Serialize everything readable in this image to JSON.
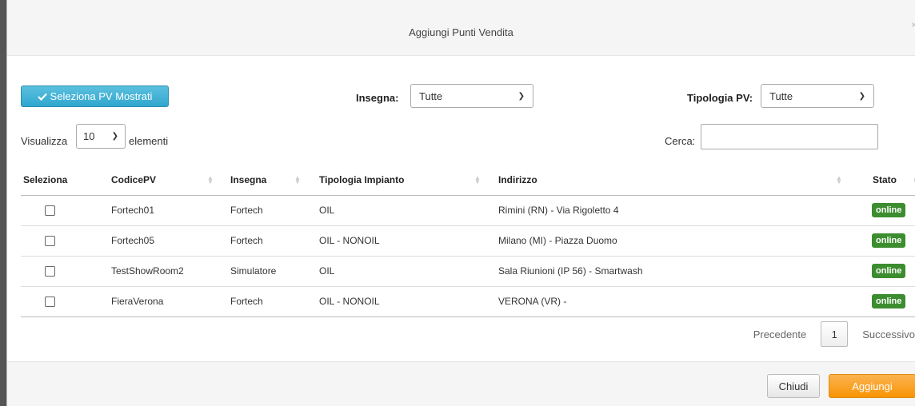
{
  "modal": {
    "title": "Aggiungi Punti Vendita",
    "close_symbol": "×"
  },
  "toolbar": {
    "select_shown_label": "Seleziona PV Mostrati",
    "select_shown_icon": "checkmark-icon",
    "insegna_label": "Insegna:",
    "insegna_value": "Tutte",
    "tipologia_label": "Tipologia PV:",
    "tipologia_value": "Tutte"
  },
  "length": {
    "prefix": "Visualizza",
    "value": "10",
    "suffix": "elementi"
  },
  "search": {
    "label": "Cerca:",
    "value": "",
    "placeholder": ""
  },
  "table": {
    "columns": [
      "Seleziona",
      "CodicePV",
      "Insegna",
      "Tipologia Impianto",
      "Indirizzo",
      "Stato"
    ],
    "rows": [
      {
        "codice": "Fortech01",
        "insegna": "Fortech",
        "tipologia": "OIL",
        "indirizzo": "Rimini (RN) - Via Rigoletto 4",
        "stato": "online"
      },
      {
        "codice": "Fortech05",
        "insegna": "Fortech",
        "tipologia": "OIL - NONOIL",
        "indirizzo": "Milano (MI) - Piazza Duomo",
        "stato": "online"
      },
      {
        "codice": "TestShowRoom2",
        "insegna": "Simulatore",
        "tipologia": "OIL",
        "indirizzo": "Sala Riunioni (IP 56) - Smartwash",
        "stato": "online"
      },
      {
        "codice": "FieraVerona",
        "insegna": "Fortech",
        "tipologia": "OIL - NONOIL",
        "indirizzo": "VERONA (VR) -",
        "stato": "online"
      }
    ]
  },
  "pagination": {
    "prev": "Precedente",
    "page": "1",
    "next": "Successivo"
  },
  "footer": {
    "close_label": "Chiudi",
    "add_label": "Aggiungi"
  },
  "colors": {
    "info_button": "#31a6cf",
    "status_online": "#3c8d2f",
    "primary_button": "#f89406"
  }
}
